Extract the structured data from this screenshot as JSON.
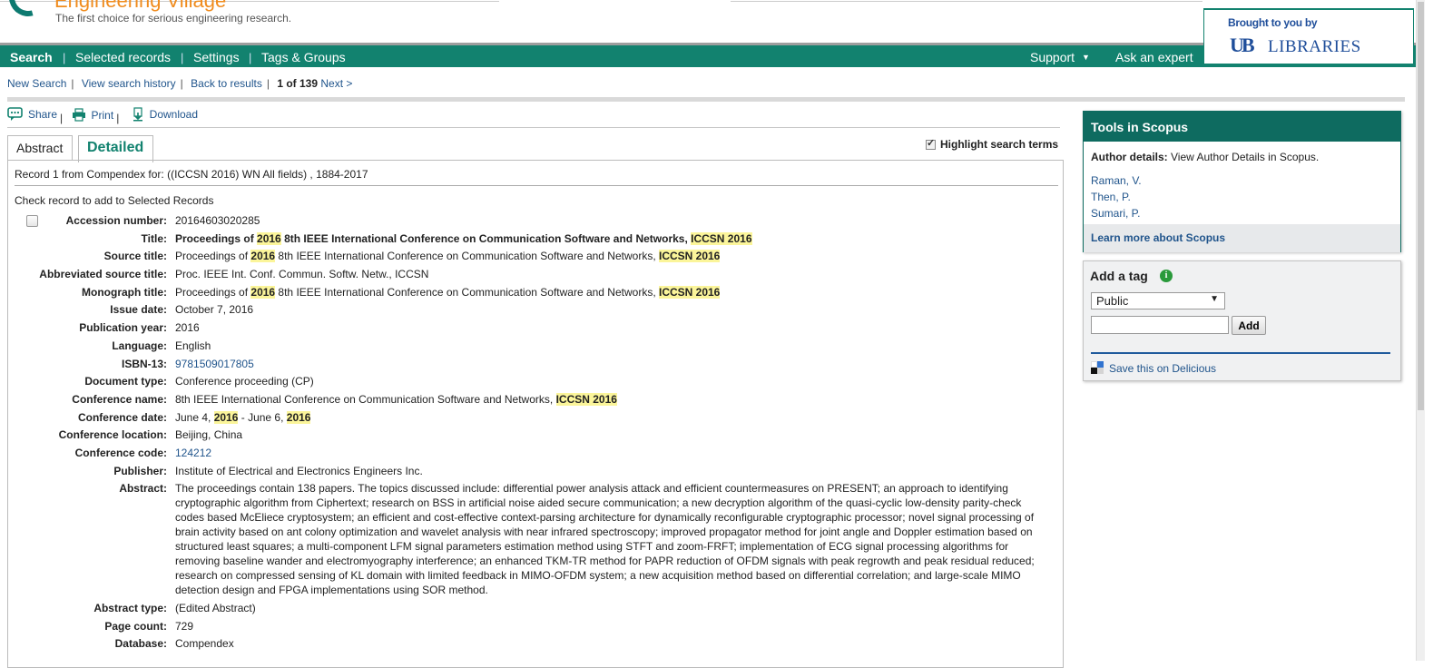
{
  "brand": {
    "title": "Engineering Village",
    "tagline": "The first choice for serious engineering research."
  },
  "nav": {
    "search": "Search",
    "selected_records": "Selected records",
    "settings": "Settings",
    "tags_groups": "Tags & Groups",
    "support": "Support",
    "ask_expert": "Ask an expert"
  },
  "library": {
    "brought": "Brought to you by",
    "ub": "UB",
    "name": "LIBRARIES"
  },
  "breadcrumbs": {
    "new_search": "New Search",
    "history": "View search history",
    "back": "Back to results",
    "position": "1 of 139",
    "next": "Next >"
  },
  "toolbar": {
    "share": "Share",
    "print": "Print",
    "download": "Download"
  },
  "tabs": {
    "abstract": "Abstract",
    "detailed": "Detailed"
  },
  "highlight_label": "Highlight search terms",
  "record": {
    "source": "Record 1 from Compendex for: ((ICCSN 2016) WN All fields) , 1884-2017",
    "check_label": "Check record to add to Selected Records",
    "accession_label": "Accession number:",
    "accession": "20164603020285",
    "title_label": "Title:",
    "title_a": "Proceedings of ",
    "title_b": "2016",
    "title_c": " 8th IEEE International Conference on Communication Software and Networks, ",
    "title_d": "ICCSN 2016",
    "source_title_label": "Source title:",
    "source_title_a": "Proceedings of ",
    "source_title_b": "2016",
    "source_title_c": " 8th IEEE International Conference on Communication Software and Networks, ",
    "source_title_d": "ICCSN 2016",
    "abbrev_label": "Abbreviated source title:",
    "abbrev": "Proc. IEEE Int. Conf. Commun. Softw. Netw., ICCSN",
    "monograph_label": "Monograph title:",
    "monograph_a": "Proceedings of ",
    "monograph_b": "2016",
    "monograph_c": " 8th IEEE International Conference on Communication Software and Networks, ",
    "monograph_d": "ICCSN 2016",
    "issue_date_label": "Issue date:",
    "issue_date": "October 7, 2016",
    "pub_year_label": "Publication year:",
    "pub_year": "2016",
    "language_label": "Language:",
    "language": "English",
    "isbn_label": "ISBN-13:",
    "isbn": "9781509017805",
    "doctype_label": "Document type:",
    "doctype": "Conference proceeding (CP)",
    "conf_name_label": "Conference name:",
    "conf_name_a": "8th IEEE International Conference on Communication Software and Networks, ",
    "conf_name_b": "ICCSN 2016",
    "conf_date_label": "Conference date:",
    "conf_date_a": "June 4, ",
    "conf_date_b": "2016",
    "conf_date_c": " - June 6, ",
    "conf_date_d": "2016",
    "conf_loc_label": "Conference location:",
    "conf_loc": "Beijing, China",
    "conf_code_label": "Conference code:",
    "conf_code": "124212",
    "publisher_label": "Publisher:",
    "publisher": "Institute of Electrical and Electronics Engineers Inc.",
    "abstract_label": "Abstract:",
    "abstract": "The proceedings contain 138 papers. The topics discussed include: differential power analysis attack and efficient countermeasures on PRESENT; an approach to identifying cryptographic algorithm from Ciphertext; research on BSS in artificial noise aided secure communication; a new decryption algorithm of the quasi-cyclic low-density parity-check codes based McEliece cryptosystem; an efficient and cost-effective context-parsing architecture for dynamically reconfigurable cryptographic processor; novel signal processing of brain activity based on ant colony optimization and wavelet analysis with near infrared spectroscopy; improved propagator method for joint angle and Doppler estimation based on structured least squares; a multi-component LFM signal parameters estimation method using STFT and zoom-FRFT; implementation of ECG signal processing algorithms for removing baseline wander and electromyography interference; an enhanced TKM-TR method for PAPR reduction of OFDM signals with peak regrowth and peak residual reduced; research on compressed sensing of KL domain with limited feedback in MIMO-OFDM system; a new acquisition method based on differential correlation; and large-scale MIMO detection design and FPGA implementations using SOR method.",
    "abstract_type_label": "Abstract type:",
    "abstract_type": "(Edited Abstract)",
    "page_count_label": "Page count:",
    "page_count": "729",
    "database_label": "Database:",
    "database": "Compendex"
  },
  "scopus": {
    "heading": "Tools in Scopus",
    "author_label": "Author details:",
    "author_text": " View Author Details in Scopus.",
    "authors": [
      "Raman, V.",
      "Then, P.",
      "Sumari, P."
    ],
    "learn_more": "Learn more about Scopus"
  },
  "tag": {
    "heading": "Add a tag",
    "visibility": "Public",
    "input_value": "",
    "add": "Add",
    "delicious": "Save this on Delicious"
  },
  "colors": {
    "nav": "#12826f",
    "scopus_head": "#0e6b60",
    "link": "#21558c",
    "highlight": "#fbf59a",
    "brand_orange": "#f08c1e"
  }
}
